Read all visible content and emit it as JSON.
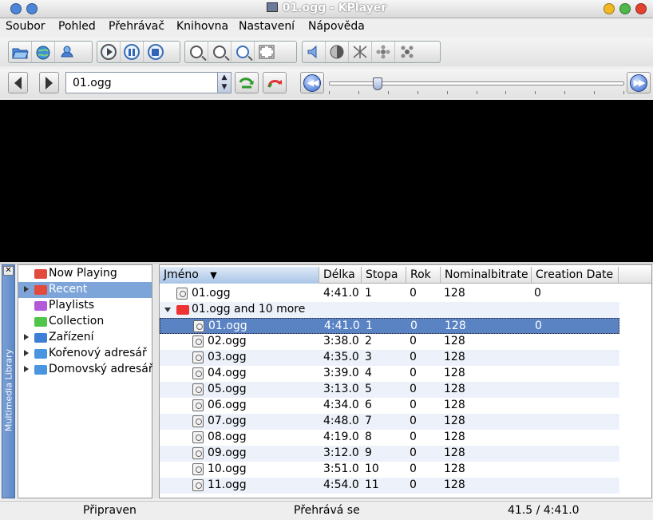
{
  "window": {
    "title": "01.ogg - KPlayer",
    "buttons": {
      "minimize_color": "#f2b824",
      "maximize_color": "#4fb84a",
      "close_color": "#e2422f",
      "left_color": "#4d86d9"
    }
  },
  "menubar": {
    "items": [
      "Soubor",
      "Pohled",
      "Přehrávač",
      "Knihovna",
      "Nastavení",
      "Nápověda"
    ]
  },
  "toolbar": {
    "file_group": [
      "open-folder-icon",
      "open-url-icon",
      "open-device-icon"
    ],
    "transport_group": [
      "play-icon",
      "pause-icon",
      "stop-icon"
    ],
    "zoom_group": [
      "zoom-in-icon",
      "zoom-out-icon",
      "zoom-fit-icon",
      "fullscreen-icon"
    ],
    "audio_group": [
      "volume-icon",
      "balance-icon",
      "contrast-icon",
      "brightness-icon",
      "saturation-icon"
    ]
  },
  "location": {
    "current_file": "01.ogg",
    "progress_fraction": 0.165
  },
  "library": {
    "side_label": "Multimedia Library",
    "tree": [
      {
        "label": "Now Playing",
        "folder_color": "#e24a3b",
        "expandable": false,
        "selected": false
      },
      {
        "label": "Recent",
        "folder_color": "#e24a3b",
        "expandable": true,
        "selected": true
      },
      {
        "label": "Playlists",
        "folder_color": "#b45ad9",
        "expandable": false,
        "selected": false
      },
      {
        "label": "Collection",
        "folder_color": "#4fc64a",
        "expandable": false,
        "selected": false
      },
      {
        "label": "Zařízení",
        "folder_color": "#3e7fd6",
        "expandable": true,
        "selected": false
      },
      {
        "label": "Kořenový adresář",
        "folder_color": "#4a95e0",
        "expandable": true,
        "selected": false
      },
      {
        "label": "Domovský adresář",
        "folder_color": "#4a95e0",
        "expandable": true,
        "selected": false
      }
    ]
  },
  "list": {
    "columns": [
      "Jméno",
      "Délka",
      "Stopa",
      "Rok",
      "Nominalbitrate",
      "Creation Date"
    ],
    "sort_indicator": "▼",
    "top_item": {
      "name": "01.ogg",
      "length": "4:41.0",
      "track": "1",
      "year": "0",
      "bitrate": "128",
      "date": "0"
    },
    "group": {
      "name": "01.ogg and 10 more"
    },
    "rows": [
      {
        "name": "01.ogg",
        "length": "4:41.0",
        "track": "1",
        "year": "0",
        "bitrate": "128",
        "date": "0"
      },
      {
        "name": "02.ogg",
        "length": "3:38.0",
        "track": "2",
        "year": "0",
        "bitrate": "128",
        "date": ""
      },
      {
        "name": "03.ogg",
        "length": "4:35.0",
        "track": "3",
        "year": "0",
        "bitrate": "128",
        "date": ""
      },
      {
        "name": "04.ogg",
        "length": "3:39.0",
        "track": "4",
        "year": "0",
        "bitrate": "128",
        "date": ""
      },
      {
        "name": "05.ogg",
        "length": "3:13.0",
        "track": "5",
        "year": "0",
        "bitrate": "128",
        "date": ""
      },
      {
        "name": "06.ogg",
        "length": "4:34.0",
        "track": "6",
        "year": "0",
        "bitrate": "128",
        "date": ""
      },
      {
        "name": "07.ogg",
        "length": "4:48.0",
        "track": "7",
        "year": "0",
        "bitrate": "128",
        "date": ""
      },
      {
        "name": "08.ogg",
        "length": "4:19.0",
        "track": "8",
        "year": "0",
        "bitrate": "128",
        "date": ""
      },
      {
        "name": "09.ogg",
        "length": "3:12.0",
        "track": "9",
        "year": "0",
        "bitrate": "128",
        "date": ""
      },
      {
        "name": "10.ogg",
        "length": "3:51.0",
        "track": "10",
        "year": "0",
        "bitrate": "128",
        "date": ""
      },
      {
        "name": "11.ogg",
        "length": "4:54.0",
        "track": "11",
        "year": "0",
        "bitrate": "128",
        "date": ""
      }
    ]
  },
  "status": {
    "state": "Připraven",
    "playback": "Přehrává se",
    "time": "41.5 / 4:41.0"
  }
}
